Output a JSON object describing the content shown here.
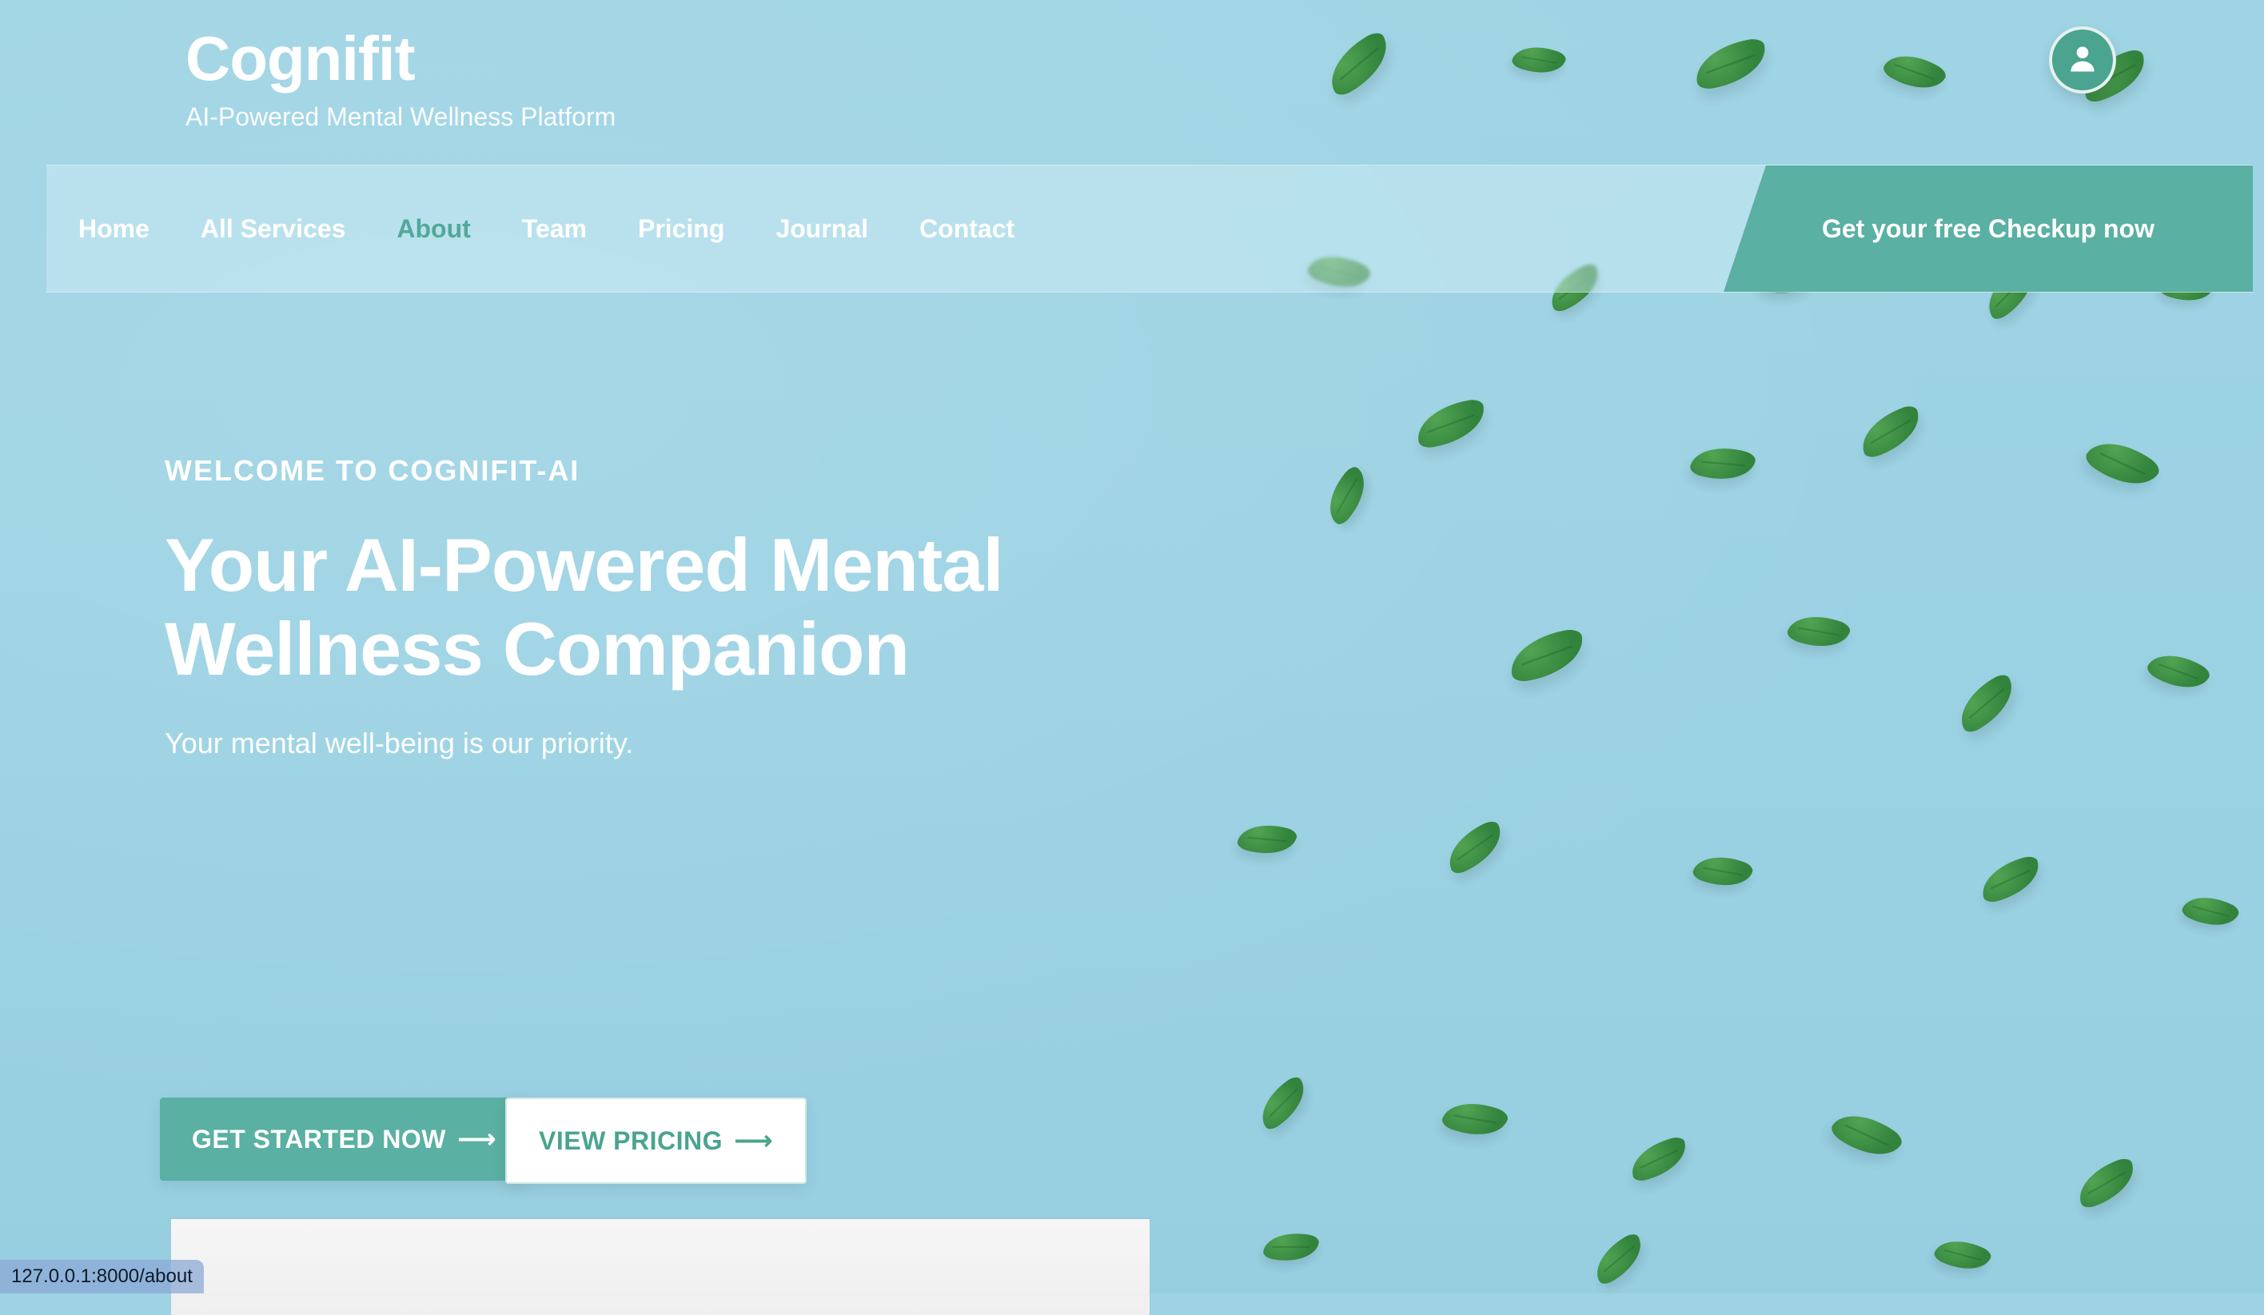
{
  "brand": {
    "title": "Cognifit",
    "subtitle": "AI-Powered Mental Wellness Platform"
  },
  "header": {
    "avatar_icon": "user-icon"
  },
  "nav": {
    "items": [
      {
        "label": "Home"
      },
      {
        "label": "All Services"
      },
      {
        "label": "About"
      },
      {
        "label": "Team"
      },
      {
        "label": "Pricing"
      },
      {
        "label": "Journal"
      },
      {
        "label": "Contact"
      }
    ],
    "active_label": "About",
    "cta_label": "Get your free Checkup now"
  },
  "hero": {
    "eyebrow": "WELCOME TO COGNIFIT-AI",
    "headline": "Your AI-Powered Mental Wellness Companion",
    "subtext": "Your mental well-being is our priority.",
    "buttons": {
      "primary_label": "GET STARTED NOW",
      "secondary_label": "VIEW PRICING",
      "arrow_glyph": "⟶"
    }
  },
  "status_bar": {
    "url": "127.0.0.1:8000/about"
  },
  "colors": {
    "accent": "#5ab0a2",
    "accent_text": "#52a89a"
  }
}
